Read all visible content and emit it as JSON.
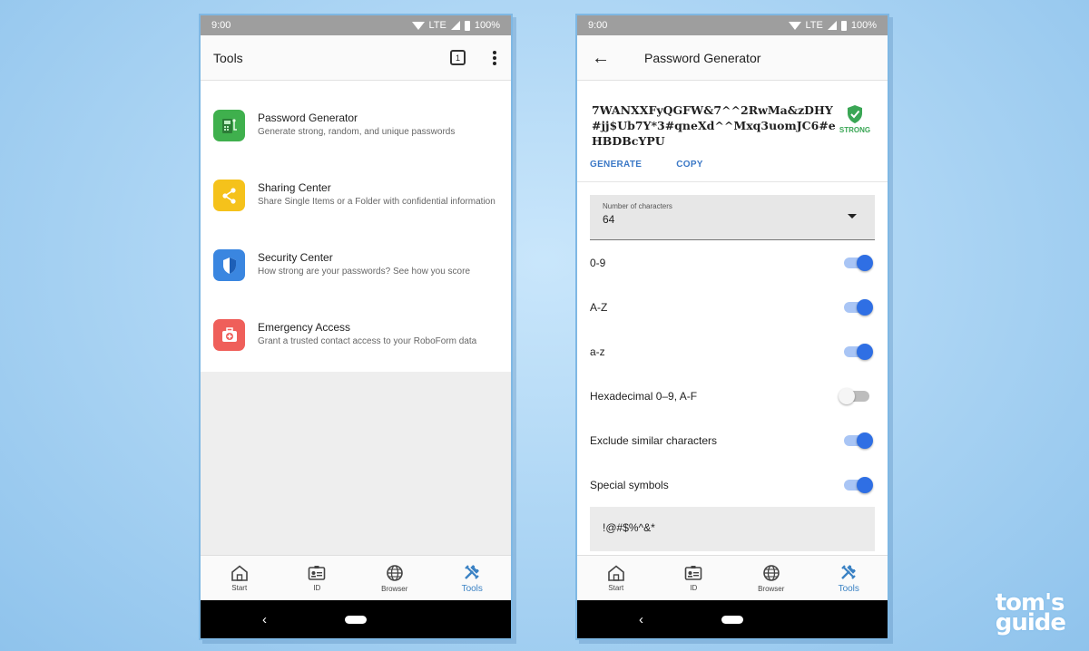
{
  "left_screen": {
    "status": {
      "time": "9:00",
      "network": "LTE",
      "battery": "100%"
    },
    "appbar": {
      "title": "Tools",
      "tab_count": "1"
    },
    "tools": [
      {
        "title": "Password Generator",
        "description": "Generate strong, random, and unique passwords",
        "icon": "password-generator-icon",
        "color": "#3fb04d"
      },
      {
        "title": "Sharing Center",
        "description": "Share Single Items or a Folder with confidential information",
        "icon": "share-icon",
        "color": "#f5c21b"
      },
      {
        "title": "Security Center",
        "description": "How strong are your passwords? See how you score",
        "icon": "shield-icon",
        "color": "#3a86e0"
      },
      {
        "title": "Emergency Access",
        "description": "Grant a trusted contact access to your RoboForm data",
        "icon": "emergency-kit-icon",
        "color": "#ef5f5a"
      }
    ],
    "nav": [
      {
        "label": "Start",
        "icon": "home-icon"
      },
      {
        "label": "ID",
        "icon": "id-card-icon"
      },
      {
        "label": "Browser",
        "icon": "globe-icon"
      },
      {
        "label": "Tools",
        "icon": "tools-icon",
        "active": true
      }
    ]
  },
  "right_screen": {
    "status": {
      "time": "9:00",
      "network": "LTE",
      "battery": "100%"
    },
    "appbar": {
      "title": "Password Generator"
    },
    "password": {
      "value": "7WANXXFyQGFW&7^^2RwMa&zDHY#jj$Ub7Y*3#qneXd^^Mxq3uomJC6#eHBDBcYPU",
      "strength": "STRONG",
      "strength_color": "#3aa655"
    },
    "actions": {
      "generate": "GENERATE",
      "copy": "COPY"
    },
    "num_chars": {
      "label": "Number of characters",
      "value": "64"
    },
    "options": [
      {
        "label": "0-9",
        "on": true
      },
      {
        "label": "A-Z",
        "on": true
      },
      {
        "label": "a-z",
        "on": true
      },
      {
        "label": "Hexadecimal 0–9, A-F",
        "on": false
      },
      {
        "label": "Exclude similar characters",
        "on": true
      },
      {
        "label": "Special symbols",
        "on": true
      }
    ],
    "symbols": "!@#$%^&*",
    "nav": [
      {
        "label": "Start",
        "icon": "home-icon"
      },
      {
        "label": "ID",
        "icon": "id-card-icon"
      },
      {
        "label": "Browser",
        "icon": "globe-icon"
      },
      {
        "label": "Tools",
        "icon": "tools-icon",
        "active": true
      }
    ]
  },
  "watermark": {
    "line1": "tom's",
    "line2": "guide"
  },
  "colors": {
    "accent": "#3b82c4",
    "toggle_on": "#2f6fe4"
  }
}
